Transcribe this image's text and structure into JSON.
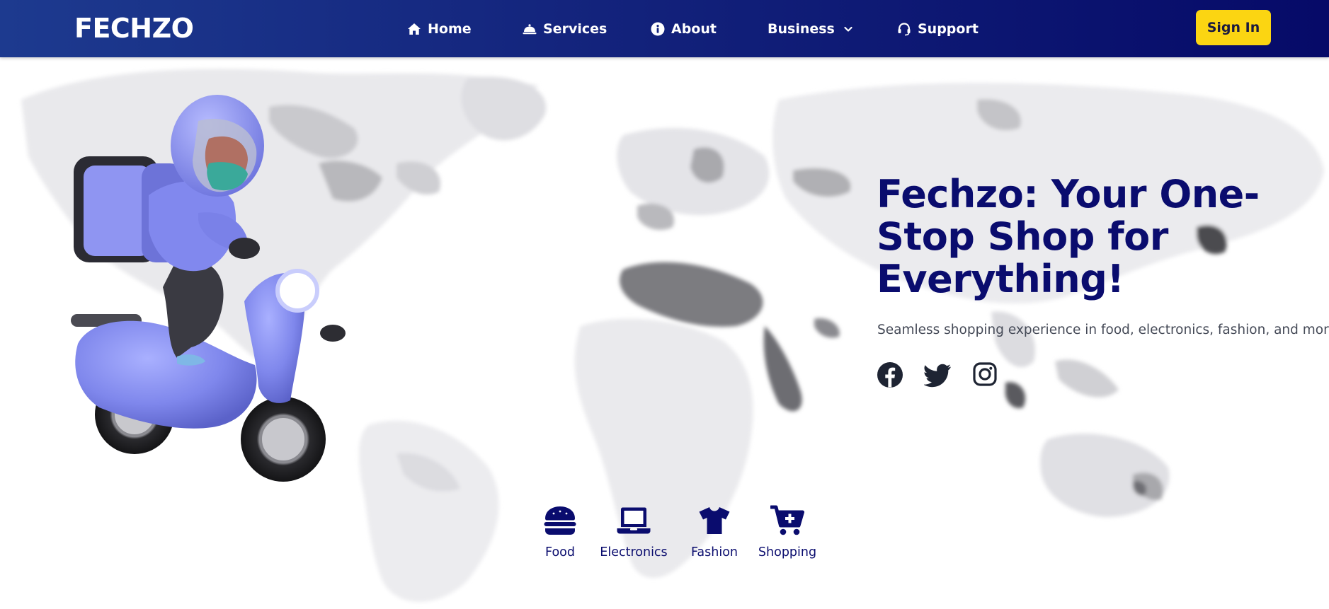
{
  "navbar": {
    "brand": "FECHZO",
    "items": [
      {
        "label": "Home",
        "icon": "home-icon"
      },
      {
        "label": "Services",
        "icon": "cloche-icon"
      },
      {
        "label": "About",
        "icon": "info-icon"
      },
      {
        "label": "Business",
        "icon": "chevron-down-icon"
      },
      {
        "label": "Support",
        "icon": "headset-icon"
      }
    ],
    "signin_label": "Sign In",
    "colors": {
      "bar_start": "#1d3a8f",
      "bar_end": "#060a68",
      "signin_bg": "#fbd512"
    }
  },
  "hero": {
    "title": "Fechzo: Your One-Stop Shop for Everything!",
    "subtitle": "Seamless shopping experience in food, electronics, fashion, and more.",
    "social": [
      {
        "name": "facebook-icon"
      },
      {
        "name": "twitter-icon"
      },
      {
        "name": "instagram-icon"
      }
    ],
    "title_color": "#0a0c6e"
  },
  "categories": [
    {
      "label": "Food",
      "icon": "burger-icon"
    },
    {
      "label": "Electronics",
      "icon": "laptop-icon"
    },
    {
      "label": "Fashion",
      "icon": "tshirt-icon"
    },
    {
      "label": "Shopping",
      "icon": "cart-plus-icon"
    }
  ]
}
